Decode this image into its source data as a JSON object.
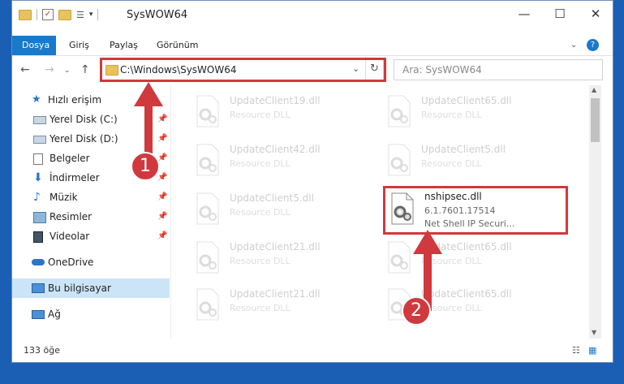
{
  "window": {
    "title": "SysWOW64"
  },
  "ribbon": {
    "tabs": [
      "Dosya",
      "Giriş",
      "Paylaş",
      "Görünüm"
    ]
  },
  "address": {
    "path": "C:\\Windows\\SysWOW64"
  },
  "search": {
    "placeholder": "Ara: SysWOW64"
  },
  "sidebar": {
    "items": [
      {
        "label": "Hızlı erişim",
        "icon": "star-icon"
      },
      {
        "label": "Yerel Disk (C:)",
        "icon": "drive-icon",
        "pinned": true
      },
      {
        "label": "Yerel Disk (D:)",
        "icon": "drive-icon",
        "pinned": true
      },
      {
        "label": "Belgeler",
        "icon": "documents-icon",
        "pinned": true
      },
      {
        "label": "İndirmeler",
        "icon": "download-icon",
        "pinned": true
      },
      {
        "label": "Müzik",
        "icon": "music-icon",
        "pinned": true
      },
      {
        "label": "Resimler",
        "icon": "pictures-icon",
        "pinned": true
      },
      {
        "label": "Videolar",
        "icon": "videos-icon",
        "pinned": true
      },
      {
        "label": "OneDrive",
        "icon": "cloud-icon"
      },
      {
        "label": "Bu bilgisayar",
        "icon": "computer-icon",
        "selected": true
      },
      {
        "label": "Ağ",
        "icon": "network-icon"
      }
    ]
  },
  "files": [
    {
      "name": "UpdateClient19.dll",
      "type": "Resource DLL"
    },
    {
      "name": "UpdateClient65.dll",
      "type": "Resource DLL"
    },
    {
      "name": "UpdateClient42.dll",
      "type": "Resource DLL"
    },
    {
      "name": "UpdateClient5.dll",
      "type": "Resource DLL"
    },
    {
      "name": "UpdateClient5.dll",
      "type": "Resource DLL"
    },
    {
      "name": "nshipsec.dll",
      "version": "6.1.7601.17514",
      "description": "Net Shell IP Securi..."
    },
    {
      "name": "UpdateClient21.dll",
      "type": "Resource DLL"
    },
    {
      "name": "UpdateClient65.dll",
      "type": "Resource DLL"
    },
    {
      "name": "UpdateClient21.dll",
      "type": "Resource DLL"
    },
    {
      "name": "UpdateClient65.dll",
      "type": "Resource DLL"
    }
  ],
  "status": {
    "count": "133 öğe"
  },
  "callouts": {
    "step1": "1",
    "step2": "2"
  },
  "colors": {
    "accent": "#1979ca",
    "highlight": "#d0393d",
    "selected": "#cce4f7"
  }
}
